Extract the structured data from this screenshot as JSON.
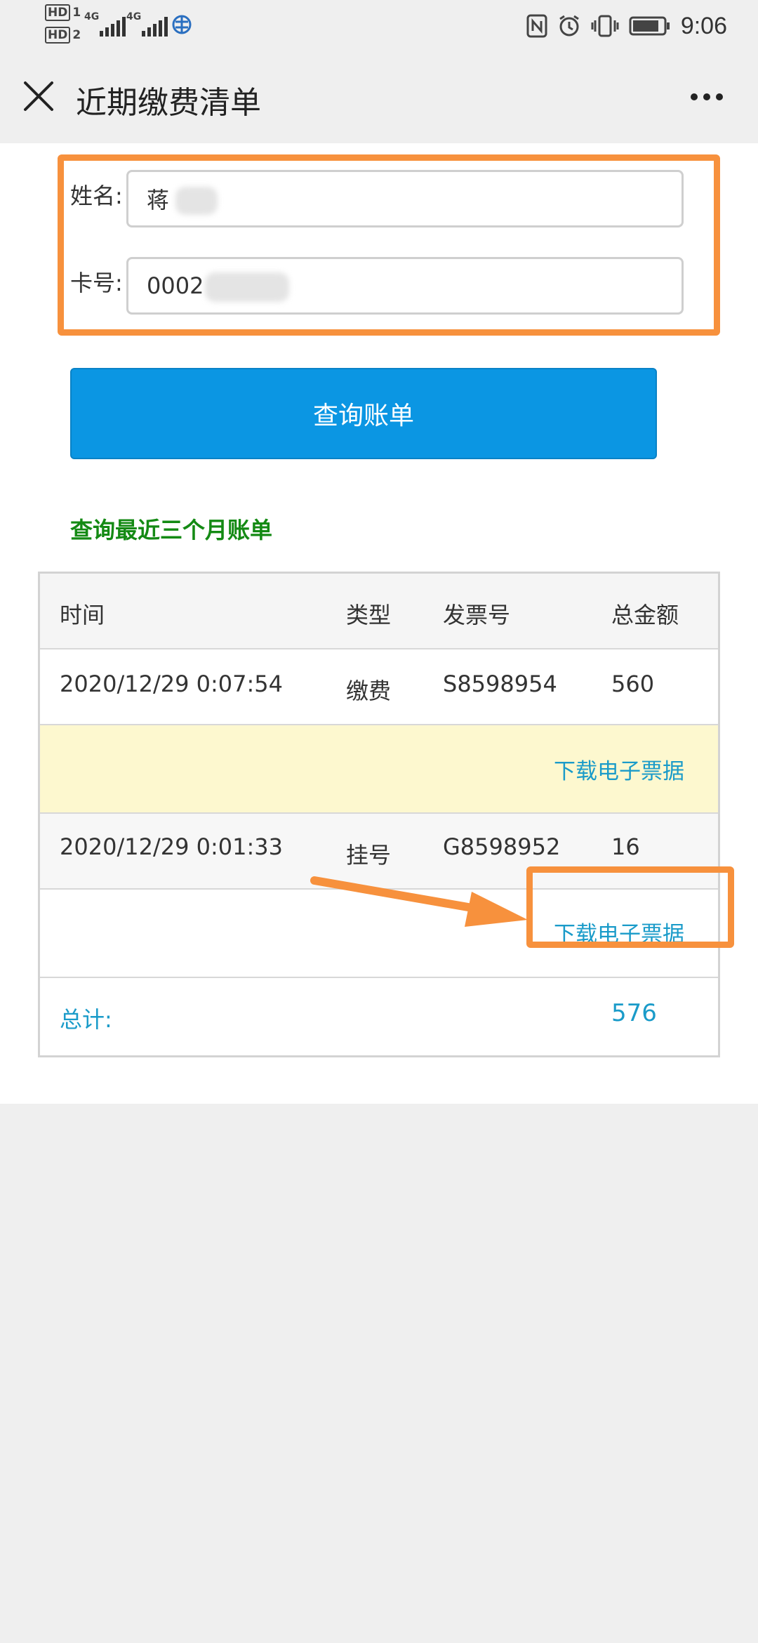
{
  "status_bar": {
    "hd1": "HD",
    "hd1_sub": "1",
    "hd2": "HD",
    "hd2_sub": "2",
    "sim1": "4G",
    "sim2": "4G",
    "time": "9:06"
  },
  "header": {
    "title": "近期缴费清单"
  },
  "form": {
    "name_label": "姓名:",
    "name_value": "蒋",
    "card_label": "卡号:",
    "card_value": "0002"
  },
  "query_button": "查询账单",
  "recent_link": "查询最近三个月账单",
  "table": {
    "headers": [
      "时间",
      "类型",
      "发票号",
      "总金额"
    ],
    "rows": [
      {
        "time": "2020/12/29 0:07:54",
        "type": "缴费",
        "invoice": "S8598954",
        "amount": "560",
        "download": "下载电子票据"
      },
      {
        "time": "2020/12/29 0:01:33",
        "type": "挂号",
        "invoice": "G8598952",
        "amount": "16",
        "download": "下载电子票据"
      }
    ],
    "total_label": "总计:",
    "total_value": "576"
  },
  "colors": {
    "accent_orange": "#f7913d",
    "button_blue": "#0b96e3",
    "link_green": "#148a14",
    "link_blue": "#1a9bc9"
  }
}
